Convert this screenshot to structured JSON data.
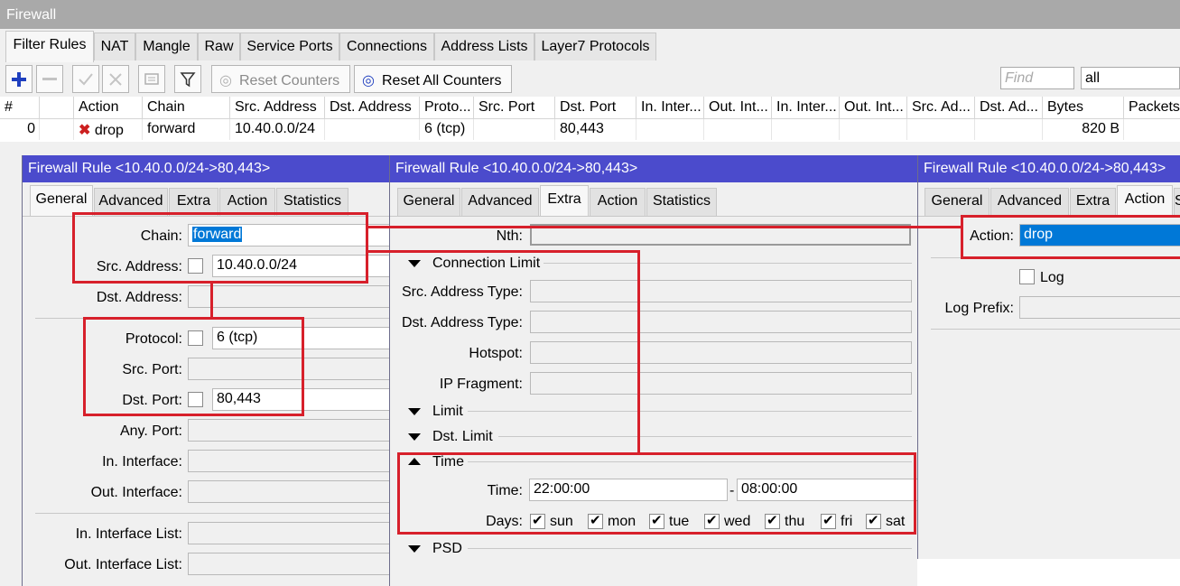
{
  "window": {
    "title": "Firewall"
  },
  "tabs": [
    "Filter Rules",
    "NAT",
    "Mangle",
    "Raw",
    "Service Ports",
    "Connections",
    "Address Lists",
    "Layer7 Protocols"
  ],
  "toolbar": {
    "reset_counters": "Reset Counters",
    "reset_all_counters": "Reset All Counters",
    "find_placeholder": "Find",
    "filter_value": "all"
  },
  "table": {
    "headers": [
      "#",
      "",
      "Action",
      "Chain",
      "Src. Address",
      "Dst. Address",
      "Proto...",
      "Src. Port",
      "Dst. Port",
      "In. Inter...",
      "Out. Int...",
      "In. Inter...",
      "Out. Int...",
      "Src. Ad...",
      "Dst. Ad...",
      "Bytes",
      "Packets"
    ],
    "rows": [
      {
        "num": "0",
        "action": "drop",
        "chain": "forward",
        "src_address": "10.40.0.0/24",
        "dst_address": "",
        "protocol": "6 (tcp)",
        "src_port": "",
        "dst_port": "80,443",
        "bytes": "820 B",
        "packets": ""
      }
    ]
  },
  "panel_title": "Firewall Rule <10.40.0.0/24->80,443>",
  "panel_tabs": [
    "General",
    "Advanced",
    "Extra",
    "Action",
    "Statistics"
  ],
  "general": {
    "chain_label": "Chain:",
    "chain_value": "forward",
    "src_address_label": "Src. Address:",
    "src_address_value": "10.40.0.0/24",
    "dst_address_label": "Dst. Address:",
    "protocol_label": "Protocol:",
    "protocol_value": "6 (tcp)",
    "src_port_label": "Src. Port:",
    "dst_port_label": "Dst. Port:",
    "dst_port_value": "80,443",
    "any_port_label": "Any. Port:",
    "in_interface_label": "In. Interface:",
    "out_interface_label": "Out. Interface:",
    "in_interface_list_label": "In. Interface List:",
    "out_interface_list_label": "Out. Interface List:"
  },
  "extra": {
    "nth_label": "Nth:",
    "connection_limit": "Connection Limit",
    "src_address_type_label": "Src. Address Type:",
    "dst_address_type_label": "Dst. Address Type:",
    "hotspot_label": "Hotspot:",
    "ip_fragment_label": "IP Fragment:",
    "limit": "Limit",
    "dst_limit": "Dst. Limit",
    "time": "Time",
    "time_label": "Time:",
    "time_from": "22:00:00",
    "time_dash": "-",
    "time_to": "08:00:00",
    "days_label": "Days:",
    "days": [
      "sun",
      "mon",
      "tue",
      "wed",
      "thu",
      "fri",
      "sat"
    ],
    "psd": "PSD"
  },
  "action": {
    "action_label": "Action:",
    "action_value": "drop",
    "log_label": "Log",
    "log_prefix_label": "Log Prefix:"
  },
  "colors": {
    "titlebar": "#4b4bcc",
    "highlight": "#d7202b",
    "selection": "#0078d7",
    "add_icon": "#1f3fbf",
    "drop_icon": "#cc1f1f"
  }
}
